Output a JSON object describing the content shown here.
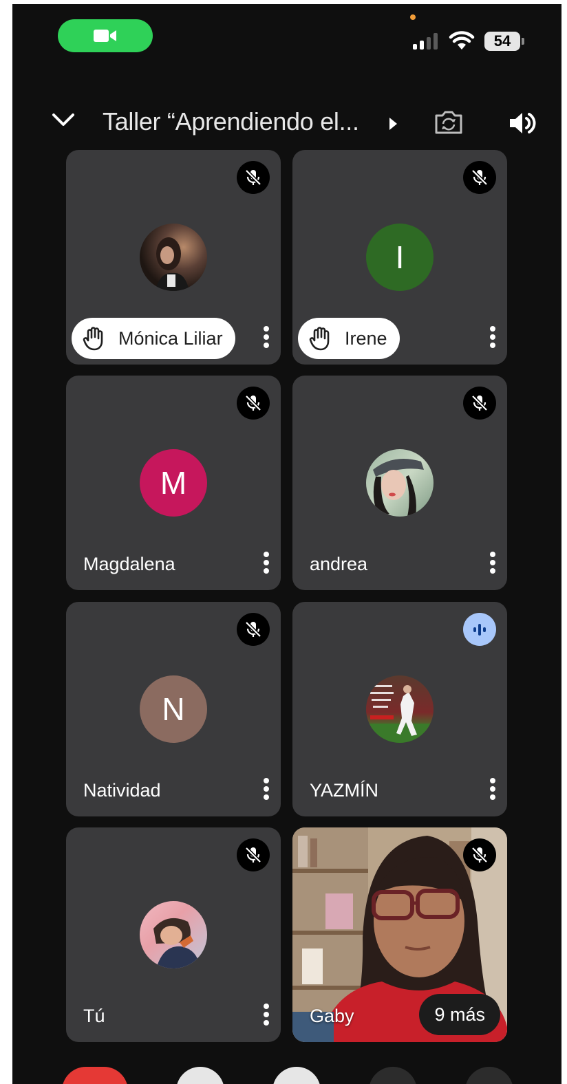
{
  "status_bar": {
    "battery_level": "54",
    "signal_bars_filled": 2,
    "signal_bars_total": 4,
    "call_indicator_color": "#2fd158"
  },
  "header": {
    "meeting_title": "Taller “Aprendiendo el...",
    "collapse_icon": "chevron-down-icon",
    "details_icon": "play-arrow-icon",
    "switch_camera_icon": "camera-flip-icon",
    "audio_icon": "speaker-icon"
  },
  "participants": [
    {
      "name": "Mónica Liliar",
      "hand_raised": true,
      "muted": true,
      "avatar_type": "photo"
    },
    {
      "name": "Irene",
      "hand_raised": true,
      "muted": true,
      "avatar_type": "initial",
      "initial": "I",
      "avatar_color": "#2e6a24"
    },
    {
      "name": "Magdalena",
      "hand_raised": false,
      "muted": true,
      "avatar_type": "initial",
      "initial": "M",
      "avatar_color": "#c6175c"
    },
    {
      "name": "andrea",
      "hand_raised": false,
      "muted": true,
      "avatar_type": "photo"
    },
    {
      "name": "Natividad",
      "hand_raised": false,
      "muted": true,
      "avatar_type": "initial",
      "initial": "N",
      "avatar_color": "#8b6b60"
    },
    {
      "name": "YAZMÍN",
      "hand_raised": false,
      "muted": false,
      "speaking": true,
      "avatar_type": "photo"
    },
    {
      "name": "Tú",
      "hand_raised": false,
      "muted": true,
      "avatar_type": "photo"
    },
    {
      "name": "Gaby",
      "hand_raised": false,
      "muted": true,
      "avatar_type": "video"
    }
  ],
  "overflow": {
    "label": "9 más"
  }
}
